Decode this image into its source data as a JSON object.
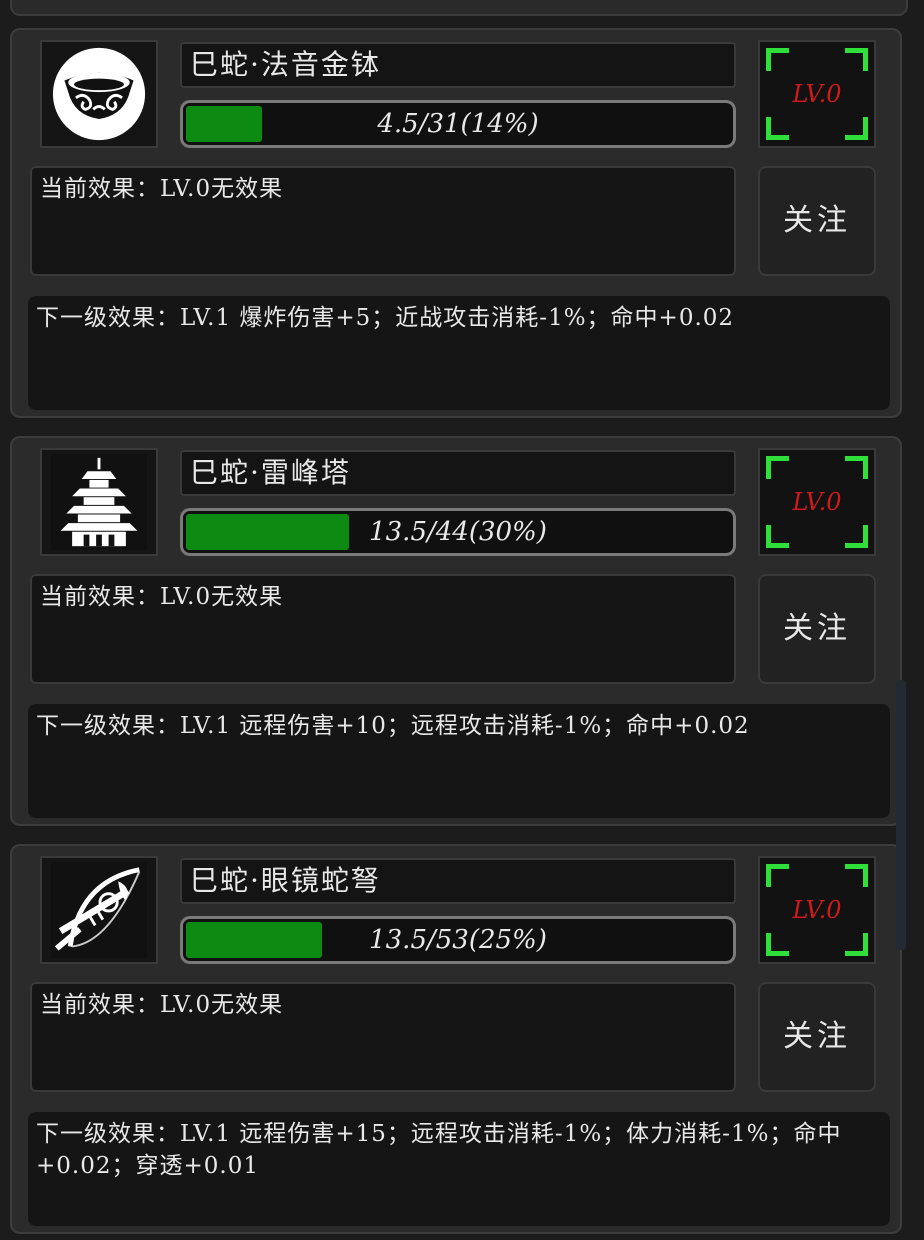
{
  "items": [
    {
      "name": "巳蛇·法音金钵",
      "icon": "bowl-icon",
      "progress_text": "4.5/31(14%)",
      "progress_fraction": 0.14,
      "level": "LV.0",
      "current_effect": "当前效果：LV.0无效果",
      "follow_label": "关注",
      "next_effect": "下一级效果：LV.1 爆炸伤害+5；近战攻击消耗-1%；命中+0.02"
    },
    {
      "name": "巳蛇·雷峰塔",
      "icon": "pagoda-icon",
      "progress_text": "13.5/44(30%)",
      "progress_fraction": 0.3,
      "level": "LV.0",
      "current_effect": "当前效果：LV.0无效果",
      "follow_label": "关注",
      "next_effect": "下一级效果：LV.1 远程伤害+10；远程攻击消耗-1%；命中+0.02"
    },
    {
      "name": "巳蛇·眼镜蛇弩",
      "icon": "crossbow-icon",
      "progress_text": "13.5/53(25%)",
      "progress_fraction": 0.25,
      "level": "LV.0",
      "current_effect": "当前效果：LV.0无效果",
      "follow_label": "关注",
      "next_effect": "下一级效果：LV.1 远程伤害+15；远程攻击消耗-1%；体力消耗-1%；命中+0.02；穿透+0.01"
    }
  ],
  "colors": {
    "progress_fill": "#0d8a12",
    "level_text": "#d01a1a",
    "corner_accent": "#2fe03a"
  }
}
